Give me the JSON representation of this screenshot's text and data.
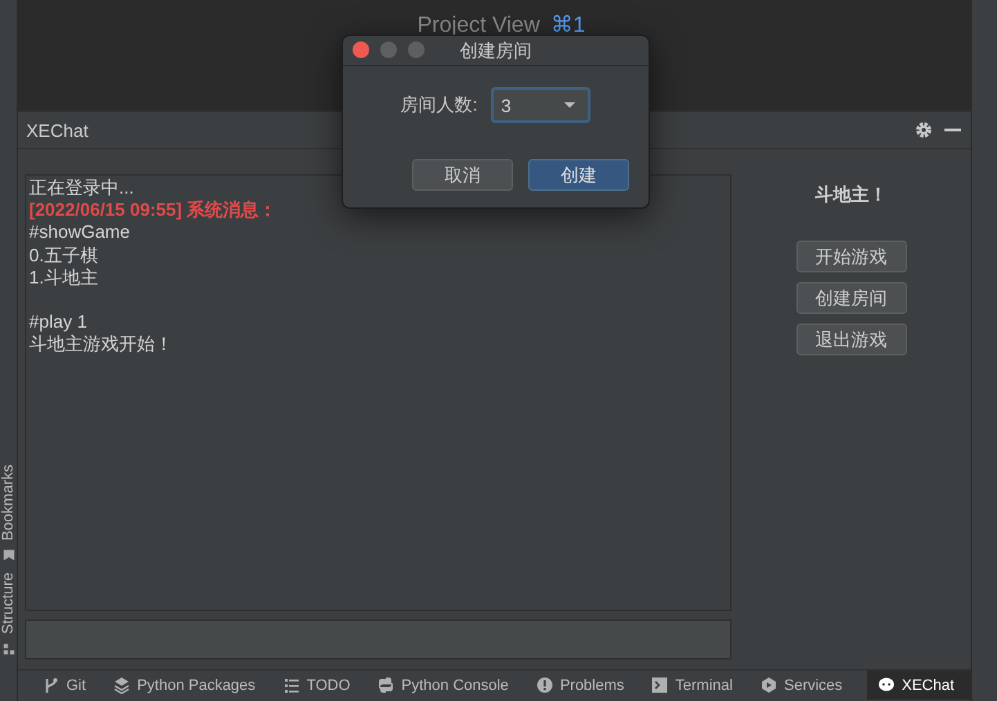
{
  "editor_hint": {
    "label": "Project View",
    "shortcut": "⌘1"
  },
  "panel": {
    "title": "XEChat"
  },
  "chat_lines": [
    {
      "kind": "normal",
      "text": "正在登录中..."
    },
    {
      "kind": "system",
      "text": "[2022/06/15 09:55] 系统消息："
    },
    {
      "kind": "normal",
      "text": "#showGame"
    },
    {
      "kind": "normal",
      "text": "0.五子棋"
    },
    {
      "kind": "normal",
      "text": "1.斗地主"
    },
    {
      "kind": "blank"
    },
    {
      "kind": "normal",
      "text": "#play 1"
    },
    {
      "kind": "normal",
      "text": "斗地主游戏开始！"
    }
  ],
  "game": {
    "title": "斗地主！",
    "buttons": [
      "开始游戏",
      "创建房间",
      "退出游戏"
    ]
  },
  "side_tools": [
    {
      "label": "Bookmarks",
      "kind": "bookmark"
    },
    {
      "label": "Structure",
      "kind": "structure"
    }
  ],
  "bottom_tabs": [
    {
      "label": "Git",
      "kind": "git",
      "selected": false
    },
    {
      "label": "Python Packages",
      "kind": "layers",
      "selected": false
    },
    {
      "label": "TODO",
      "kind": "list",
      "selected": false
    },
    {
      "label": "Python Console",
      "kind": "python",
      "selected": false
    },
    {
      "label": "Problems",
      "kind": "alert",
      "selected": false
    },
    {
      "label": "Terminal",
      "kind": "terminal",
      "selected": false
    },
    {
      "label": "Services",
      "kind": "play",
      "selected": false
    },
    {
      "label": "XEChat",
      "kind": "chat",
      "selected": true
    }
  ],
  "dialog": {
    "title": "创建房间",
    "field_label": "房间人数:",
    "select_value": "3",
    "buttons": [
      {
        "label": "取消",
        "kind": "secondary"
      },
      {
        "label": "创建",
        "kind": "primary"
      }
    ]
  }
}
